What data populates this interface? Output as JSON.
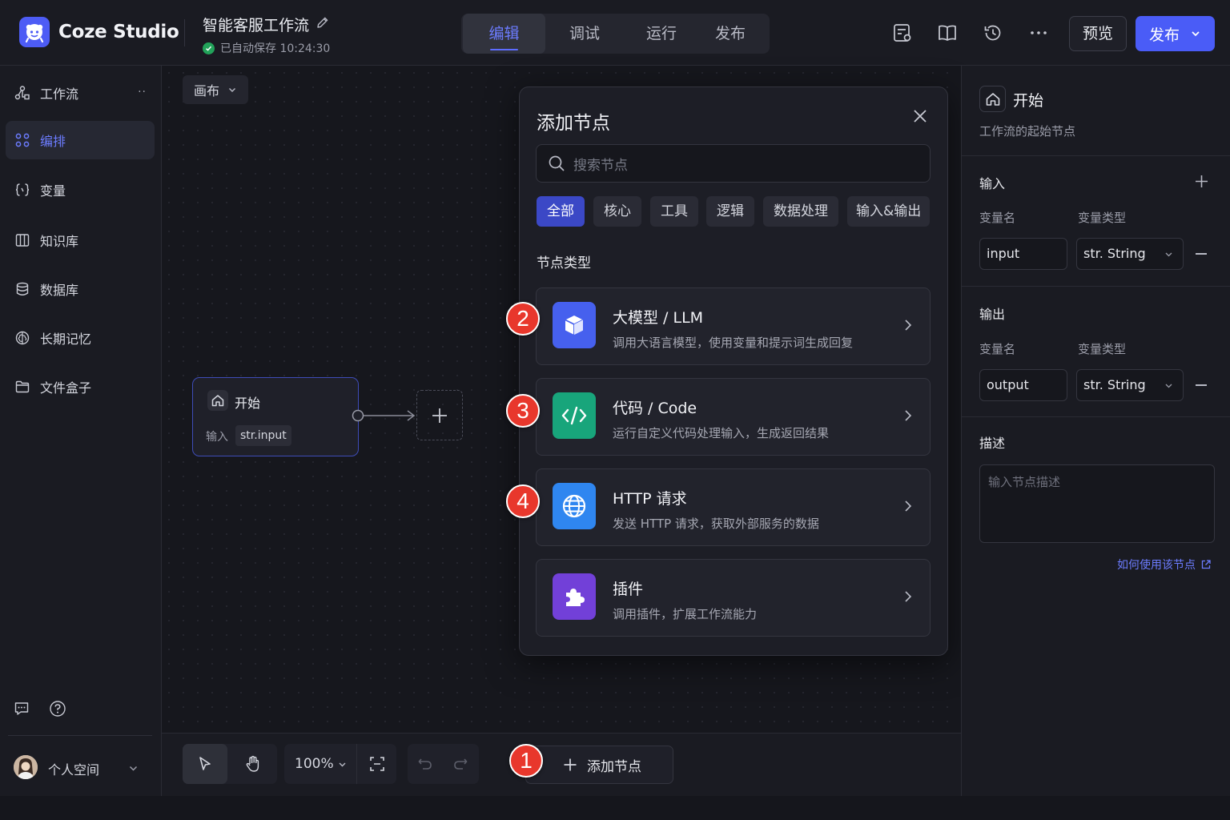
{
  "header": {
    "brand": "Coze Studio",
    "workflow_title": "智能客服工作流",
    "save_status": "已自动保存 10:24:30",
    "tabs": [
      {
        "label": "编辑",
        "active": true
      },
      {
        "label": "调试",
        "active": false
      },
      {
        "label": "运行",
        "active": false
      },
      {
        "label": "发布",
        "active": false
      }
    ],
    "preview_label": "预览",
    "publish_label": "发布",
    "accent_color": "#4a5cf7"
  },
  "sidebar": {
    "items": [
      {
        "label": "工作流",
        "icon": "workflow-icon",
        "active": false
      },
      {
        "label": "编排",
        "icon": "orchestrate-icon",
        "active": true
      },
      {
        "label": "变量",
        "icon": "braces-icon",
        "active": false
      },
      {
        "label": "知识库",
        "icon": "knowledge-icon",
        "active": false
      },
      {
        "label": "数据库",
        "icon": "database-icon",
        "active": false
      },
      {
        "label": "长期记忆",
        "icon": "brain-icon",
        "active": false
      },
      {
        "label": "文件盒子",
        "icon": "folder-icon",
        "active": false
      }
    ],
    "more": "··",
    "user_space": "个人空间"
  },
  "canvas": {
    "view_label": "画布",
    "start_node": {
      "title": "开始",
      "input_label": "输入",
      "input_value": "str.input"
    }
  },
  "toolbar": {
    "zoom": "100%",
    "add_node_label": "添加节点"
  },
  "badges": [
    "1",
    "2",
    "3",
    "4"
  ],
  "add_node_panel": {
    "title": "添加节点",
    "search_placeholder": "搜索节点",
    "filters": [
      {
        "label": "全部",
        "active": true
      },
      {
        "label": "核心",
        "active": false
      },
      {
        "label": "工具",
        "active": false
      },
      {
        "label": "逻辑",
        "active": false
      },
      {
        "label": "数据处理",
        "active": false
      },
      {
        "label": "输入&输出",
        "active": false
      }
    ],
    "section_label": "节点类型",
    "nodes": [
      {
        "title": "大模型 / LLM",
        "desc": "调用大语言模型，使用变量和提示词生成回复",
        "icon": "cube-icon",
        "color": "#4660ee"
      },
      {
        "title": "代码 / Code",
        "desc": "运行自定义代码处理输入，生成返回结果",
        "icon": "code-icon",
        "color": "#18a57b"
      },
      {
        "title": "HTTP 请求",
        "desc": "发送 HTTP 请求，获取外部服务的数据",
        "icon": "globe-icon",
        "color": "#2f86f0"
      },
      {
        "title": "插件",
        "desc": "调用插件，扩展工作流能力",
        "icon": "puzzle-icon",
        "color": "#7240d8"
      }
    ]
  },
  "properties": {
    "title": "开始",
    "subtitle": "工作流的起始节点",
    "input_heading": "输入",
    "output_heading": "输出",
    "col_name": "变量名",
    "col_type": "变量类型",
    "input_var": {
      "name": "input",
      "type": "str. String"
    },
    "output_var": {
      "name": "output",
      "type": "str. String"
    },
    "desc_heading": "描述",
    "desc_placeholder": "输入节点描述",
    "help_link": "如何使用该节点"
  }
}
